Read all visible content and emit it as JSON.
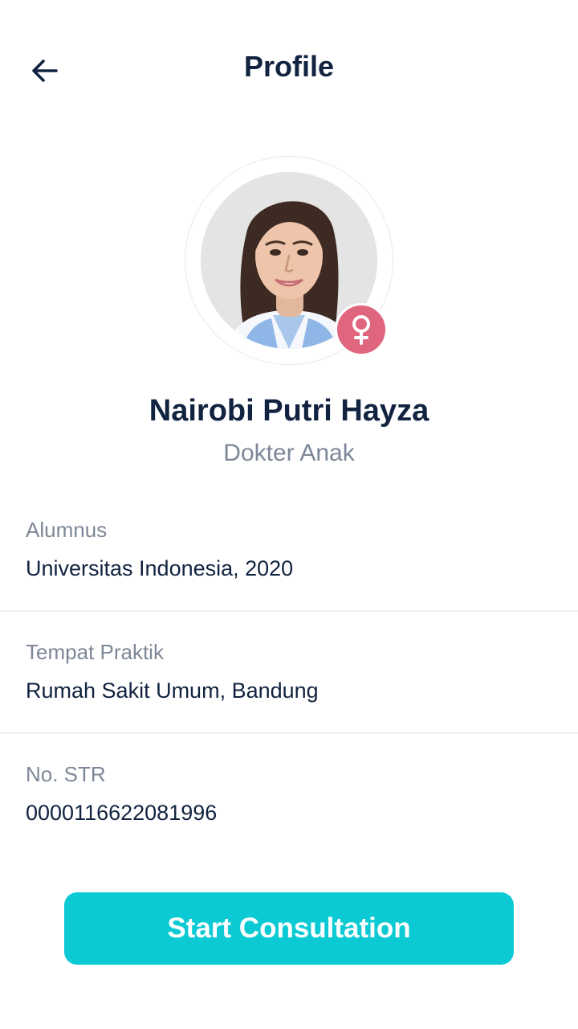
{
  "header": {
    "title": "Profile",
    "back_icon": "arrow-left-icon"
  },
  "profile": {
    "name": "Nairobi Putri Hayza",
    "role": "Dokter Anak",
    "gender_icon": "female-icon",
    "gender_badge_color": "#E0657E"
  },
  "details": [
    {
      "label": "Alumnus",
      "value": "Universitas Indonesia, 2020"
    },
    {
      "label": "Tempat Praktik",
      "value": "Rumah Sakit Umum, Bandung"
    },
    {
      "label": "No. STR",
      "value": "0000116622081996"
    }
  ],
  "cta": {
    "label": "Start Consultation",
    "color": "#0BCAD4"
  },
  "colors": {
    "text_primary": "#112340",
    "text_secondary": "#7D8797",
    "divider": "#EEEEEE"
  }
}
